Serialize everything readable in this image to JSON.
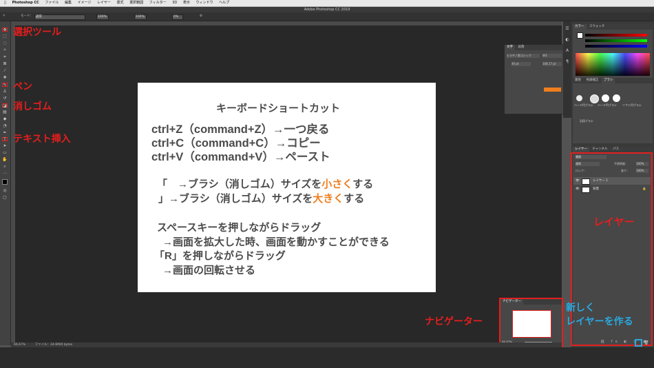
{
  "menubar": {
    "app_name": "Photoshop CC",
    "items": [
      "ファイル",
      "編集",
      "イメージ",
      "レイヤー",
      "書式",
      "選択範囲",
      "フィルター",
      "3D",
      "表示",
      "ウィンドウ",
      "ヘルプ"
    ]
  },
  "window": {
    "title": "Adobe Photoshop CC 2019"
  },
  "options": {
    "mode_label": "モード：",
    "mode_value": "通常",
    "opacity": "100%",
    "flow": "100%",
    "smoothing": "0%"
  },
  "document": {
    "heading": "キーボードショートカット",
    "shortcuts": [
      "ctrl+Z（command+Z）→一つ戻る",
      "ctrl+C（command+C）→コピー",
      "ctrl+V（command+V）→ペースト"
    ],
    "brush_small": {
      "prefix": "「　→ブラシ（消しゴム）サイズを",
      "highlight": "小さく",
      "suffix": "する"
    },
    "brush_large": {
      "prefix": "」→ブラシ（消しゴム）サイズを",
      "highlight": "大きく",
      "suffix": "する"
    },
    "space_line1": "スペースキーを押しながらドラッグ",
    "space_line2": "→画面を拡大した時、画面を動かすことができる",
    "r_line1": "「R」を押しながらドラッグ",
    "r_line2": "→画面の回転させる"
  },
  "annotations": {
    "select_tool": "選択ツール",
    "pen": "ペン",
    "eraser": "消しゴム",
    "text": "テキスト挿入",
    "layers": "レイヤー",
    "navigator": "ナビゲーター",
    "new_layer_line1": "新しく",
    "new_layer_line2": "レイヤーを作る"
  },
  "panels": {
    "color_tabs": [
      "カラー",
      "スウォッチ"
    ],
    "brush_tabs": [
      "属性",
      "色調補正",
      "ブラシ"
    ],
    "layer_tabs": [
      "レイヤー",
      "チャンネル",
      "パス"
    ],
    "layer_kind": "種類",
    "layer_mode": "通常",
    "layer_opacity_label": "不透明度：",
    "layer_opacity": "100%",
    "layer_lock_label": "ロック：",
    "layer_fill_label": "塗り：",
    "layer_fill": "100%",
    "layers": [
      "レイヤー 1",
      "背景"
    ],
    "navigator_tab": "ナビゲーター",
    "navigator_zoom": "66.67%",
    "char_tabs": [
      "文字",
      "段落"
    ],
    "char_font": "ヒラギノ角ゴシック",
    "char_weight": "W3",
    "char_size": "40 pt",
    "char_leading": "108.17 pt",
    "brush_names": [
      "ハード円ブラシ",
      "ハード円ブラシ",
      "ソフト円ブラシ"
    ],
    "brush_group": "汎用ブラシ"
  },
  "status": {
    "zoom": "66.67%",
    "file": "ファイル：24.6M/0 bytes"
  },
  "colors": {
    "annotation_red": "#e51e1e",
    "annotation_blue": "#29a9e0",
    "highlight_orange": "#f07e1f"
  }
}
